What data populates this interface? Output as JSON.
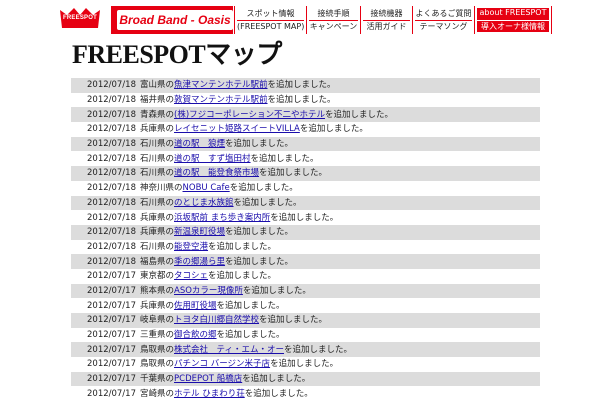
{
  "header": {
    "logo_text": "FREESPOT",
    "brand": "Broad Band - Oasis",
    "nav": [
      {
        "line1": "スポット情報",
        "line2": "(FREESPOT MAP)"
      },
      {
        "line1": "接続手順",
        "line2": "キャンペーン"
      },
      {
        "line1": "接続機器",
        "line2": "活用ガイド"
      },
      {
        "line1": "よくあるご質問",
        "line2": "テーマソング"
      },
      {
        "line1": "about FREESPOT",
        "line2": "導入オーナ様情報"
      }
    ]
  },
  "page": {
    "title": "FREESPOTマップ"
  },
  "rows": [
    {
      "date": "2012/07/18",
      "pref": "富山県の",
      "spot": "魚津マンテンホテル駅前",
      "suffix": "を追加しました。"
    },
    {
      "date": "2012/07/18",
      "pref": "福井県の",
      "spot": "敦賀マンテンホテル駅前",
      "suffix": "を追加しました。"
    },
    {
      "date": "2012/07/18",
      "pref": "青森県の",
      "spot": "(株)フジコーポレーション不二やホテル",
      "suffix": "を追加しました。"
    },
    {
      "date": "2012/07/18",
      "pref": "兵庫県の",
      "spot": "レイセニット姫路スイートVILLA",
      "suffix": "を追加しました。"
    },
    {
      "date": "2012/07/18",
      "pref": "石川県の",
      "spot": "道の駅　狼煙",
      "suffix": "を追加しました。"
    },
    {
      "date": "2012/07/18",
      "pref": "石川県の",
      "spot": "道の駅　すず塩田村",
      "suffix": "を追加しました。"
    },
    {
      "date": "2012/07/18",
      "pref": "石川県の",
      "spot": "道の駅　能登食祭市場",
      "suffix": "を追加しました。"
    },
    {
      "date": "2012/07/18",
      "pref": "神奈川県の",
      "spot": "NOBU Cafe",
      "suffix": "を追加しました。"
    },
    {
      "date": "2012/07/18",
      "pref": "石川県の",
      "spot": "のとじま水族館",
      "suffix": "を追加しました。"
    },
    {
      "date": "2012/07/18",
      "pref": "兵庫県の",
      "spot": "浜坂駅前 まち歩き案内所",
      "suffix": "を追加しました。"
    },
    {
      "date": "2012/07/18",
      "pref": "兵庫県の",
      "spot": "新温泉町役場",
      "suffix": "を追加しました。"
    },
    {
      "date": "2012/07/18",
      "pref": "石川県の",
      "spot": "能登空港",
      "suffix": "を追加しました。"
    },
    {
      "date": "2012/07/18",
      "pref": "福島県の",
      "spot": "季の郷湯ら里",
      "suffix": "を追加しました。"
    },
    {
      "date": "2012/07/17",
      "pref": "東京都の",
      "spot": "タコシェ",
      "suffix": "を追加しました。"
    },
    {
      "date": "2012/07/17",
      "pref": "熊本県の",
      "spot": "ASOカラー現像所",
      "suffix": "を追加しました。"
    },
    {
      "date": "2012/07/17",
      "pref": "兵庫県の",
      "spot": "佐用町役場",
      "suffix": "を追加しました。"
    },
    {
      "date": "2012/07/17",
      "pref": "岐阜県の",
      "spot": "トヨタ白川郷自然学校",
      "suffix": "を追加しました。"
    },
    {
      "date": "2012/07/17",
      "pref": "三重県の",
      "spot": "御合飲の郷",
      "suffix": "を追加しました。"
    },
    {
      "date": "2012/07/17",
      "pref": "鳥取県の",
      "spot": "株式会社　ティ・エム・オー",
      "suffix": "を追加しました。"
    },
    {
      "date": "2012/07/17",
      "pref": "鳥取県の",
      "spot": "パチンコ バージン米子店",
      "suffix": "を追加しました。"
    },
    {
      "date": "2012/07/17",
      "pref": "千葉県の",
      "spot": "PCDEPOT 船橋店",
      "suffix": "を追加しました。"
    },
    {
      "date": "2012/07/17",
      "pref": "宮崎県の",
      "spot": "ホテル ひまわり荘",
      "suffix": "を追加しました。"
    }
  ],
  "colors": {
    "accent": "#e60012",
    "link": "#1a0dab",
    "row_shade": "#dcdcdc"
  }
}
